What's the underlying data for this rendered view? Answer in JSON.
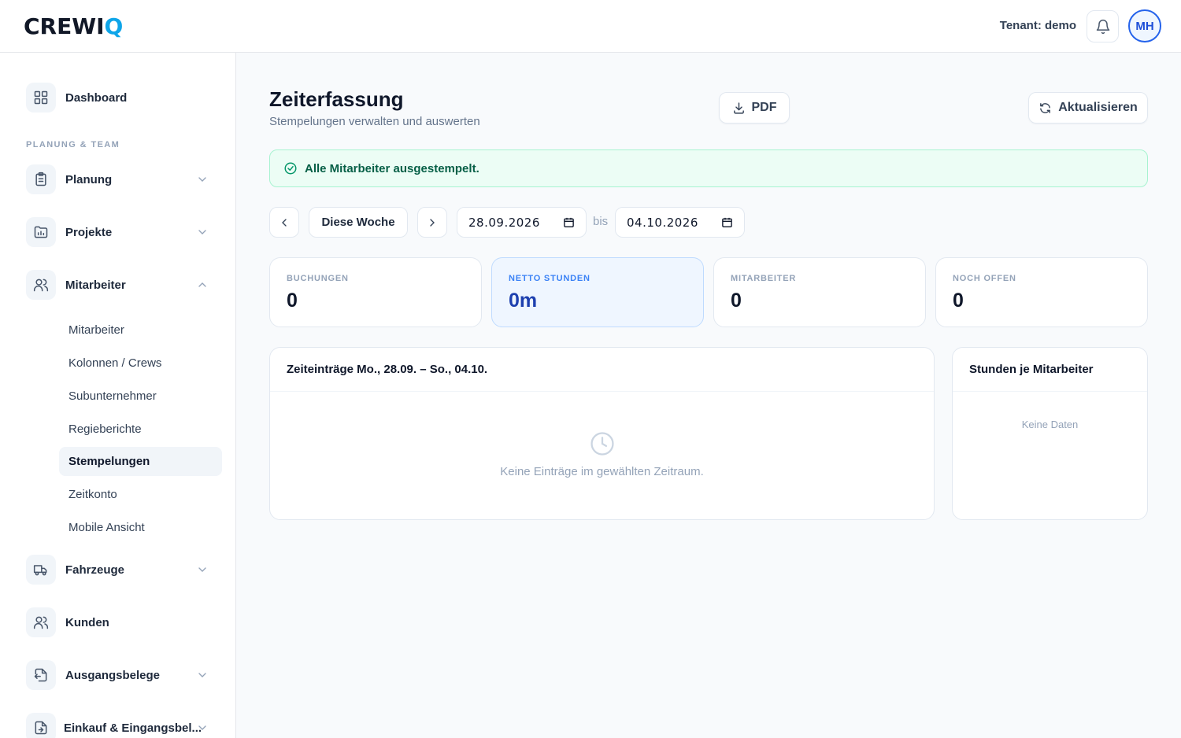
{
  "app": {
    "logo_text": "CREWIQ",
    "tenant_label": "Tenant: demo",
    "user_initials": "MH"
  },
  "sidebar": {
    "dashboard": "Dashboard",
    "section_label": "PLANUNG & TEAM",
    "planung": "Planung",
    "projekte": "Projekte",
    "mitarbeiter": "Mitarbeiter",
    "sub_items": [
      "Mitarbeiter",
      "Kolonnen / Crews",
      "Subunternehmer",
      "Regieberichte",
      "Stempelungen",
      "Zeitkonto",
      "Mobile Ansicht"
    ],
    "active_sub": "Stempelungen",
    "fahrzeuge": "Fahrzeuge",
    "kunden": "Kunden",
    "ausgangsbelege": "Ausgangsbelege",
    "einkauf": "Einkauf & Eingangsbel..."
  },
  "page": {
    "title": "Zeiterfassung",
    "subtitle": "Stempelungen verwalten und auswerten",
    "pdf_label": "PDF",
    "refresh_label": "Aktualisieren"
  },
  "alert": {
    "text": "Alle Mitarbeiter ausgestempelt."
  },
  "range": {
    "preset_label": "Diese Woche",
    "from": "28.09.2026",
    "separator": "bis",
    "to": "04.10.2026"
  },
  "stats": [
    {
      "label": "BUCHUNGEN",
      "value": "0"
    },
    {
      "label": "NETTO STUNDEN",
      "value": "0m"
    },
    {
      "label": "MITARBEITER",
      "value": "0"
    },
    {
      "label": "NOCH OFFEN",
      "value": "0"
    }
  ],
  "entries_card": {
    "title": "Zeiteinträge Mo., 28.09. – So., 04.10.",
    "empty_text": "Keine Einträge im gewählten Zeitraum."
  },
  "hours_card": {
    "title": "Stunden je Mitarbeiter",
    "empty_text": "Keine Daten"
  },
  "colors": {
    "accent": "#2563eb",
    "logo_q": "#0ea5e9",
    "success_bg": "#ecfdf5",
    "success_text": "#065f46"
  }
}
